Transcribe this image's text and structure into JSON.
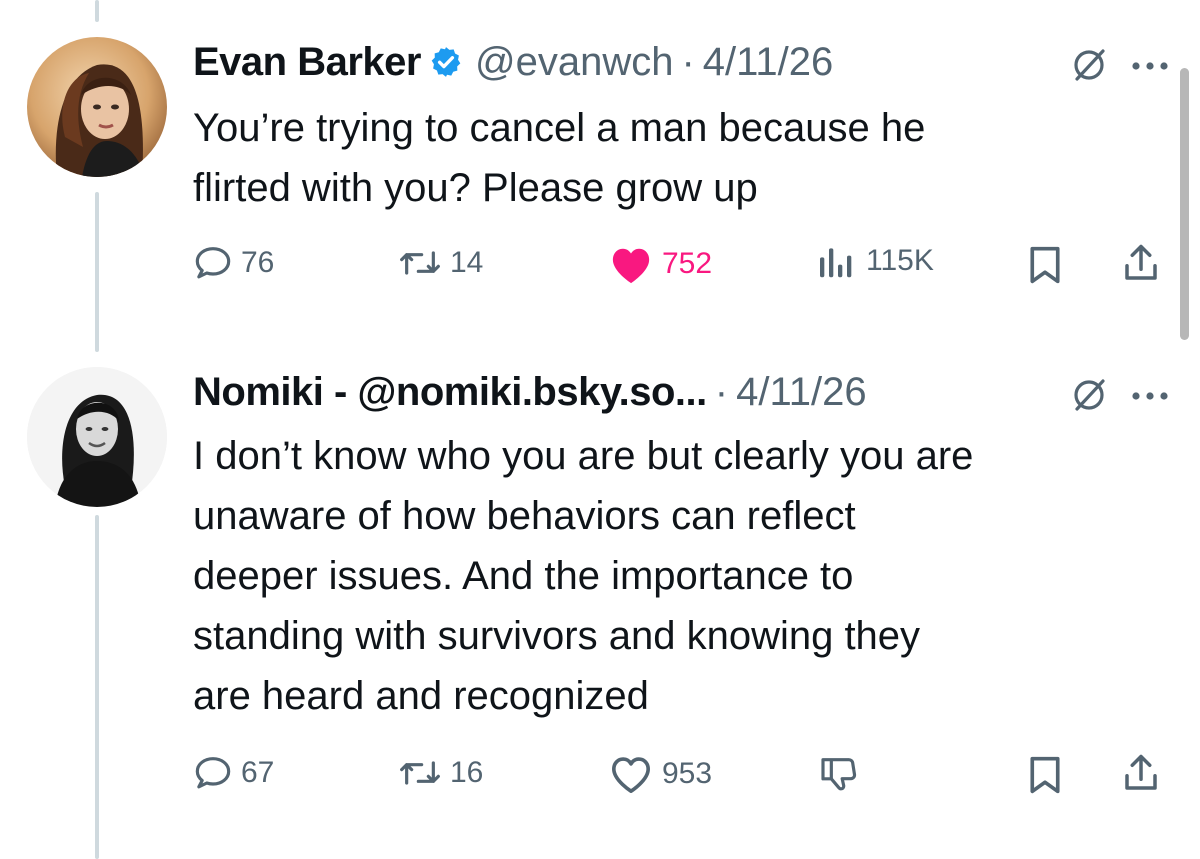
{
  "tweets": [
    {
      "author_name": "Evan Barker",
      "verified": true,
      "handle": "@evanwch",
      "separator": "·",
      "date": "4/11/26",
      "text": "You’re trying to cancel a man because he\nflirted with you? Please grow up",
      "replies": "76",
      "reposts": "14",
      "likes": "752",
      "liked": true,
      "views": "115K"
    },
    {
      "author_name": "Nomiki - @nomiki.bsky.so...",
      "verified": false,
      "handle": "",
      "separator": "·",
      "date": "4/11/26",
      "text": "I don’t know who you are but clearly you are\nunaware of how behaviors can reflect\ndeeper issues. And the importance to\nstanding with survivors and knowing they\nare heard and recognized",
      "replies": "67",
      "reposts": "16",
      "likes": "953",
      "liked": false
    }
  ],
  "icons": {
    "header": [
      "grok-icon",
      "more-icon"
    ],
    "actions": [
      "reply-icon",
      "repost-icon",
      "like-icon",
      "views-icon",
      "bookmark-icon",
      "share-icon",
      "downvote-icon"
    ]
  },
  "colors": {
    "like_active": "#f91880",
    "verified_blue": "#1d9bf0",
    "muted_text": "#536471",
    "thread_line": "#cfd9de"
  }
}
